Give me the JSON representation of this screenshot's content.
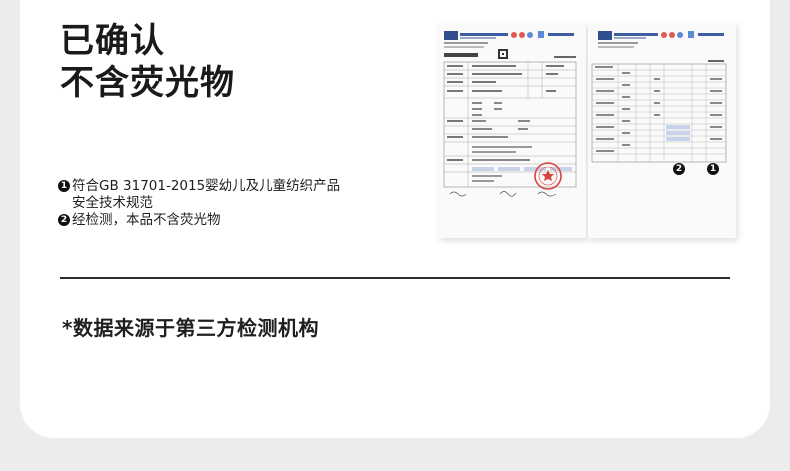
{
  "heading": {
    "line1": "已确认",
    "line2": "不含荧光物"
  },
  "points": [
    {
      "marker": "1",
      "text": "符合GB 31701-2015婴幼儿及儿童纺织产品\n安全技术规范"
    },
    {
      "marker": "2",
      "text": "经检测，本品不含荧光物"
    }
  ],
  "reports": {
    "marker_left": "2",
    "marker_right": "1"
  },
  "source_note": "*数据来源于第三方检测机构",
  "colors": {
    "accent_blue": "#2f4f8f",
    "stamp_red": "#d8443c",
    "text": "#1f1f1f"
  }
}
